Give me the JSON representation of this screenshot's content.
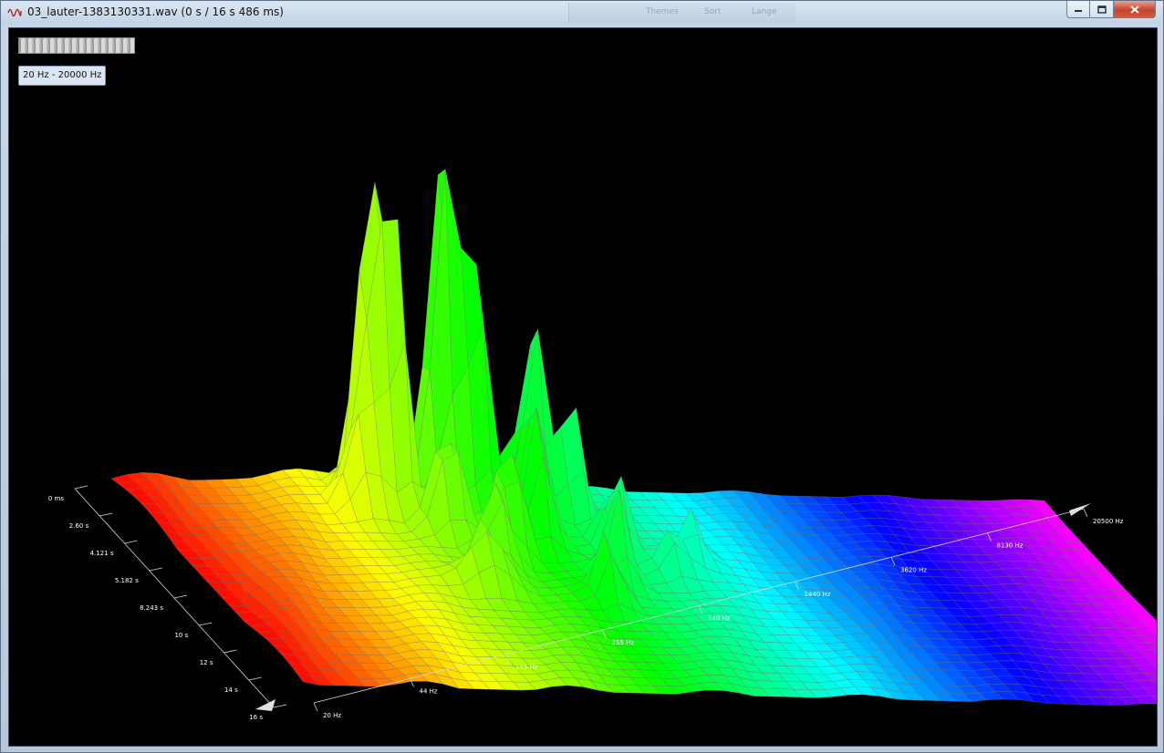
{
  "window": {
    "title": "03_lauter-1383130331.wav (0 s / 16 s 486 ms)",
    "icon": "waveform-icon",
    "menu_ghost": [
      "Themes",
      "Sort",
      "Lange"
    ]
  },
  "toolbar": {
    "range_label": "20 Hz - 20000 Hz"
  },
  "axes": {
    "time_ticks": [
      "0 ms",
      "2.60 s",
      "4.121 s",
      "5.182 s",
      "8.243 s",
      "10 s",
      "12 s",
      "14 s",
      "16 s"
    ],
    "freq_ticks": [
      "20 Hz",
      "44 Hz",
      "115 Hz",
      "255 Hz",
      "540 Hz",
      "1440 Hz",
      "3620 Hz",
      "8130 Hz",
      "20500 Hz"
    ]
  },
  "colors": {
    "low_freq": "#ff1e1e",
    "mid_freq": "#e8ff20",
    "high_freq": "#20ffff",
    "top_freq": "#ff30ff"
  }
}
